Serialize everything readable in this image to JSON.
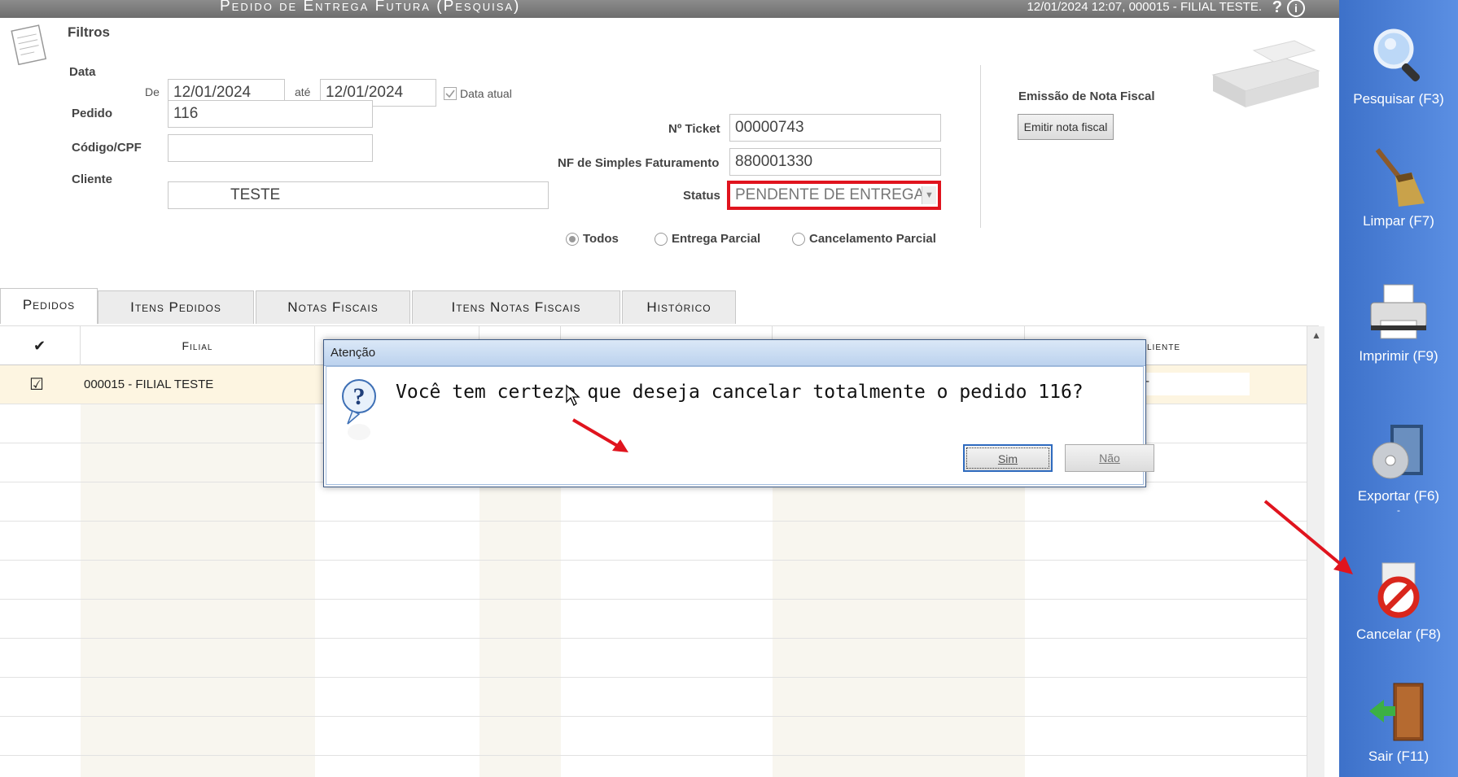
{
  "window": {
    "title": "Pedido de Entrega Futura (Pesquisa)",
    "info": "12/01/2024 12:07, 000015 - FILIAL TESTE.",
    "help": "?",
    "info_icon": "i"
  },
  "filters": {
    "section_title": "Filtros",
    "data_label": "Data",
    "de_label": "De",
    "de_value": "12/01/2024",
    "ate_label": "até",
    "ate_value": "12/01/2024",
    "data_atual_label": "Data atual",
    "data_atual_checked": true,
    "pedido_label": "Pedido",
    "pedido_value": "116",
    "codigo_label": "Código/CPF",
    "codigo_value": "",
    "cliente_label": "Cliente",
    "cliente_value": "TESTE",
    "ticket_label": "Nº Ticket",
    "ticket_value": "00000743",
    "nf_label": "NF de Simples Faturamento",
    "nf_value": "880001330",
    "status_label": "Status",
    "status_value": "PENDENTE DE ENTREGA",
    "radio_todos": "Todos",
    "radio_entrega": "Entrega Parcial",
    "radio_cancel": "Cancelamento Parcial",
    "nf_emissao_title": "Emissão de Nota Fiscal",
    "emitir_btn": "Emitir nota fiscal"
  },
  "tabs": [
    {
      "label": "Pedidos"
    },
    {
      "label": "Itens Pedidos"
    },
    {
      "label": "Notas Fiscais"
    },
    {
      "label": "Itens Notas Fiscais"
    },
    {
      "label": "Histórico"
    }
  ],
  "grid": {
    "check_header": "✔",
    "col_filial": "Filial",
    "col_cliente": "liente",
    "rows": [
      {
        "checked": "☑",
        "filial": "000015 - FILIAL TESTE",
        "cliente": "-"
      }
    ]
  },
  "sidebar": {
    "pesquisar": "Pesquisar (F3)",
    "limpar": "Limpar (F7)",
    "imprimir": "Imprimir (F9)",
    "exportar": "Exportar (F6)",
    "exportar_sub": "-",
    "cancelar": "Cancelar (F8)",
    "sair": "Sair (F11)"
  },
  "dialog": {
    "title": "Atenção",
    "message": "Você tem certeza que deseja cancelar totalmente o pedido 116?",
    "yes": "Sim",
    "no": "Não"
  },
  "colors": {
    "sidebar": "#4a80d6",
    "status_highlight": "#e0141e",
    "row_selected": "#fdf5e1",
    "annotation_arrow": "#e0141e"
  }
}
